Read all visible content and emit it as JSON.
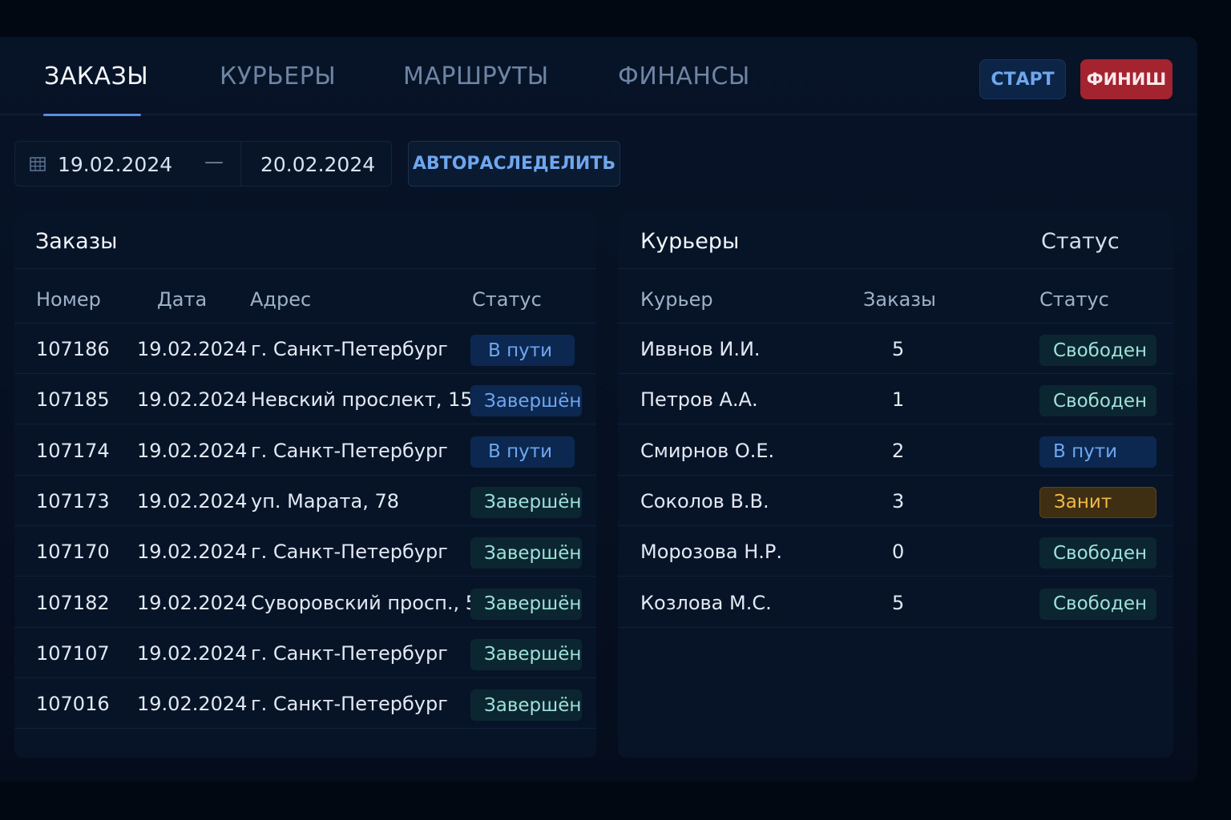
{
  "tabs": [
    {
      "label": "ЗАКАЗЫ",
      "active": true
    },
    {
      "label": "КУРЬЕРЫ",
      "active": false
    },
    {
      "label": "МАРШРУТЫ",
      "active": false
    },
    {
      "label": "ФИНАНСЫ",
      "active": false
    }
  ],
  "header": {
    "start_label": "СТАРТ",
    "finish_label": "ФИНИШ"
  },
  "daterange": {
    "from": "19.02.2024",
    "separator": "—",
    "to": "20.02.2024",
    "icon": "calendar-icon"
  },
  "toolbar": {
    "auto_label": "АВТОРАСЛЕДЕЛИТЬ"
  },
  "orders": {
    "title": "Заказы",
    "columns": [
      "Номер",
      "Дата",
      "Адрес",
      "Статус"
    ],
    "rows": [
      {
        "number": "107186",
        "date": "19.02.2024",
        "address": "г. Санкт-Петербург",
        "status": "В пути",
        "tone": "blue"
      },
      {
        "number": "107185",
        "date": "19.02.2024",
        "address": "Невский прослект, 15",
        "status": "Завершён",
        "tone": "blue"
      },
      {
        "number": "107174",
        "date": "19.02.2024",
        "address": "г. Санкт-Петербург",
        "status": "В пути",
        "tone": "blue"
      },
      {
        "number": "107173",
        "date": "19.02.2024",
        "address": "уп. Марата, 78",
        "status": "Завершён",
        "tone": "teal"
      },
      {
        "number": "107170",
        "date": "19.02.2024",
        "address": "г. Санкт-Петербург",
        "status": "Завершён",
        "tone": "teal"
      },
      {
        "number": "107182",
        "date": "19.02.2024",
        "address": "Суворовский просп., 51",
        "status": "Завершён",
        "tone": "teal"
      },
      {
        "number": "107107",
        "date": "19.02.2024",
        "address": "г. Санкт-Петербург",
        "status": "Завершён",
        "tone": "teal"
      },
      {
        "number": "107016",
        "date": "19.02.2024",
        "address": "г. Санкт-Петербург",
        "status": "Завершён",
        "tone": "teal"
      }
    ]
  },
  "couriers": {
    "title": "Курьеры",
    "title_status": "Статус",
    "columns": [
      "Курьер",
      "Заказы",
      "Статус"
    ],
    "rows": [
      {
        "name": "Иввнов И.И.",
        "orders": "5",
        "status": "Свободен",
        "tone": "teal"
      },
      {
        "name": "Петров А.А.",
        "orders": "1",
        "status": "Свободен",
        "tone": "teal"
      },
      {
        "name": "Смирнов О.Е.",
        "orders": "2",
        "status": "В пути",
        "tone": "blue"
      },
      {
        "name": "Соколов В.В.",
        "orders": "3",
        "status": "Занит",
        "tone": "amber"
      },
      {
        "name": "Морозова Н.Р.",
        "orders": "0",
        "status": "Свободен",
        "tone": "teal"
      },
      {
        "name": "Козлова М.С.",
        "orders": "5",
        "status": "Свободен",
        "tone": "teal"
      }
    ]
  },
  "colors": {
    "accent": "#5a8fe0",
    "finish_button": "#a3232e",
    "status_blue": "#6ea6f0",
    "status_teal": "#9fe0d8",
    "status_amber": "#f3b94a"
  }
}
